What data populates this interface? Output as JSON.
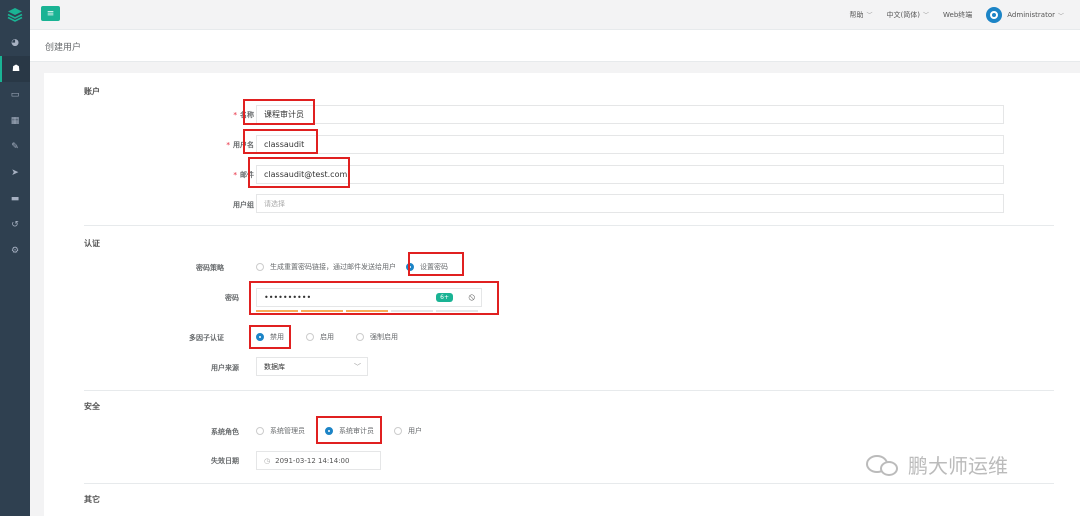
{
  "topbar": {
    "menu_icon": "menu-icon",
    "help": "帮助",
    "language": "中文(简体)",
    "web_terminal": "Web终端",
    "user": "Administrator"
  },
  "sidebar": {
    "icons": [
      "dashboard-icon",
      "users-icon",
      "inbox-icon",
      "grid-icon",
      "edit-icon",
      "send-icon",
      "monitor-icon",
      "history-icon",
      "settings-icon"
    ],
    "active": "users-icon",
    "accent": "#1ab394",
    "bg": "#2f4050"
  },
  "page": {
    "title": "创建用户"
  },
  "account": {
    "section": "账户",
    "name_label": "名称",
    "name_value": "课程审计员",
    "username_label": "用户名",
    "username_value": "classaudit",
    "email_label": "邮件",
    "email_value": "classaudit@test.com",
    "group_label": "用户组",
    "group_placeholder": "请选择"
  },
  "auth": {
    "section": "认证",
    "pwd_strategy_label": "密码策略",
    "pwd_strategy_options": [
      "生成重置密码链接，通过邮件发送给用户",
      "设置密码"
    ],
    "pwd_strategy_selected": "设置密码",
    "password_label": "密码",
    "password_value": "••••••••••",
    "password_badge": "6+",
    "strength": 0.6,
    "mfa_label": "多因子认证",
    "mfa_options": [
      "禁用",
      "启用",
      "强制启用"
    ],
    "mfa_selected": "禁用",
    "source_label": "用户来源",
    "source_value": "数据库"
  },
  "security": {
    "section": "安全",
    "role_label": "系统角色",
    "role_options": [
      "系统管理员",
      "系统审计员",
      "用户"
    ],
    "role_selected": "系统审计员",
    "expire_label": "失效日期",
    "expire_value": "2091-03-12 14:14:00"
  },
  "other": {
    "section": "其它"
  },
  "watermark": {
    "text": "鹏大师运维"
  }
}
